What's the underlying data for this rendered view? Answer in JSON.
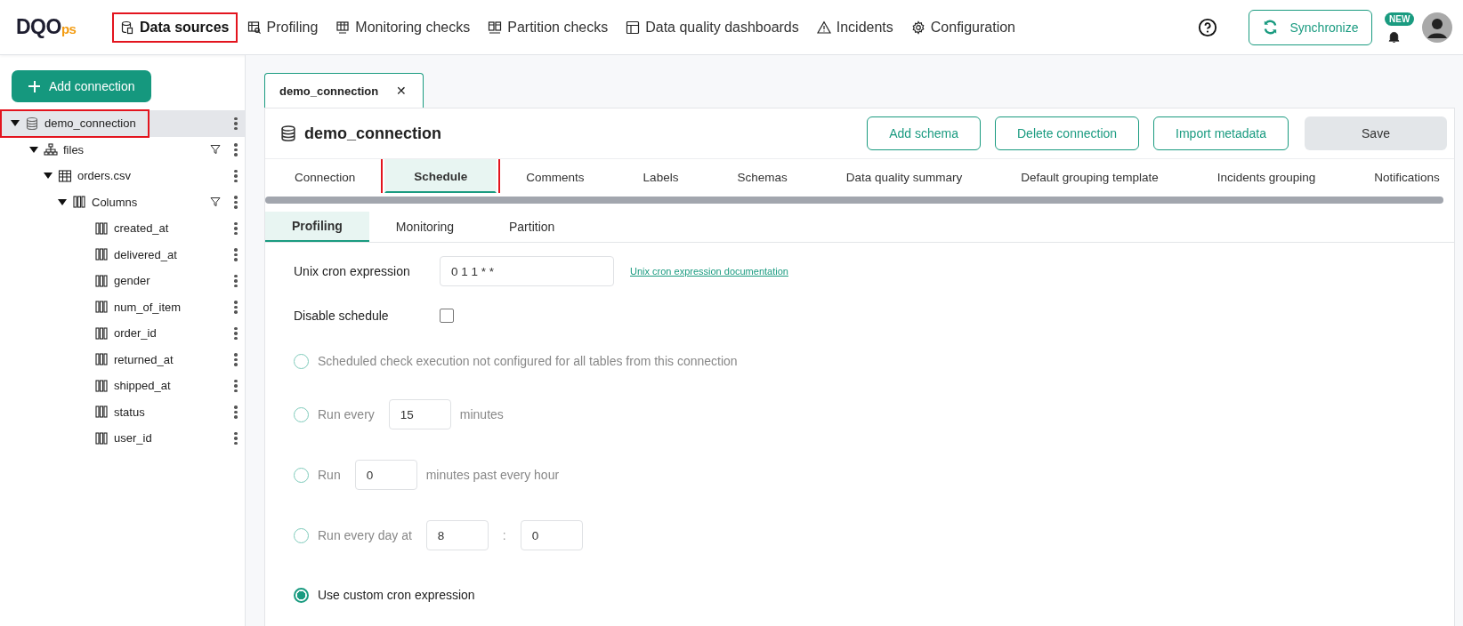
{
  "logo": {
    "main": "DQO",
    "suffix": "ps"
  },
  "nav": [
    {
      "label": "Data sources",
      "selected": true,
      "highlighted": true
    },
    {
      "label": "Profiling",
      "selected": false,
      "highlighted": false
    },
    {
      "label": "Monitoring checks",
      "selected": false,
      "highlighted": false
    },
    {
      "label": "Partition checks",
      "selected": false,
      "highlighted": false
    },
    {
      "label": "Data quality dashboards",
      "selected": false,
      "highlighted": false
    },
    {
      "label": "Incidents",
      "selected": false,
      "highlighted": false
    },
    {
      "label": "Configuration",
      "selected": false,
      "highlighted": false
    }
  ],
  "header_actions": {
    "synchronize": "Synchronize",
    "notification_badge": "NEW"
  },
  "sidebar": {
    "add_button": "Add connection",
    "tree": [
      {
        "label": "demo_connection",
        "kind": "connection",
        "expanded": true,
        "selected": true,
        "highlighted": true,
        "filter": false,
        "children": [
          {
            "label": "files",
            "kind": "schema",
            "expanded": true,
            "selected": false,
            "highlighted": false,
            "filter": true,
            "children": [
              {
                "label": "orders.csv",
                "kind": "table",
                "expanded": true,
                "selected": false,
                "highlighted": false,
                "filter": false,
                "children": [
                  {
                    "label": "Columns",
                    "kind": "columns",
                    "expanded": true,
                    "selected": false,
                    "highlighted": false,
                    "filter": true,
                    "children": [
                      {
                        "label": "created_at",
                        "kind": "column",
                        "selected": false,
                        "highlighted": false,
                        "filter": false
                      },
                      {
                        "label": "delivered_at",
                        "kind": "column",
                        "selected": false,
                        "highlighted": false,
                        "filter": false
                      },
                      {
                        "label": "gender",
                        "kind": "column",
                        "selected": false,
                        "highlighted": false,
                        "filter": false
                      },
                      {
                        "label": "num_of_item",
                        "kind": "column",
                        "selected": false,
                        "highlighted": false,
                        "filter": false
                      },
                      {
                        "label": "order_id",
                        "kind": "column",
                        "selected": false,
                        "highlighted": false,
                        "filter": false
                      },
                      {
                        "label": "returned_at",
                        "kind": "column",
                        "selected": false,
                        "highlighted": false,
                        "filter": false
                      },
                      {
                        "label": "shipped_at",
                        "kind": "column",
                        "selected": false,
                        "highlighted": false,
                        "filter": false
                      },
                      {
                        "label": "status",
                        "kind": "column",
                        "selected": false,
                        "highlighted": false,
                        "filter": false
                      },
                      {
                        "label": "user_id",
                        "kind": "column",
                        "selected": false,
                        "highlighted": false,
                        "filter": false
                      }
                    ]
                  }
                ]
              }
            ]
          }
        ]
      }
    ]
  },
  "open_tabs": [
    {
      "label": "demo_connection",
      "close": "✕",
      "selected": true
    }
  ],
  "panel": {
    "title": "demo_connection",
    "buttons": [
      {
        "label": "Add schema",
        "kind": "outline"
      },
      {
        "label": "Delete connection",
        "kind": "outline"
      },
      {
        "label": "Import metadata",
        "kind": "outline"
      },
      {
        "label": "Save",
        "kind": "disabled"
      }
    ],
    "tabs": [
      {
        "label": "Connection",
        "selected": false,
        "highlighted": false
      },
      {
        "label": "Schedule",
        "selected": true,
        "highlighted": true
      },
      {
        "label": "Comments",
        "selected": false,
        "highlighted": false
      },
      {
        "label": "Labels",
        "selected": false,
        "highlighted": false
      },
      {
        "label": "Schemas",
        "selected": false,
        "highlighted": false
      },
      {
        "label": "Data quality summary",
        "selected": false,
        "highlighted": false
      },
      {
        "label": "Default grouping template",
        "selected": false,
        "highlighted": false
      },
      {
        "label": "Incidents grouping",
        "selected": false,
        "highlighted": false
      },
      {
        "label": "Notifications",
        "selected": false,
        "highlighted": false
      }
    ],
    "subtabs": [
      {
        "label": "Profiling",
        "selected": true
      },
      {
        "label": "Monitoring",
        "selected": false
      },
      {
        "label": "Partition",
        "selected": false
      }
    ],
    "form": {
      "cron_label": "Unix cron expression",
      "cron_value": "0 1 1 * *",
      "cron_link": "Unix cron expression documentation",
      "disable_label": "Disable schedule",
      "disable_checked": false,
      "options": [
        {
          "kind": "text",
          "label": "Scheduled check execution not configured for all tables from this connection",
          "selected": false
        },
        {
          "kind": "every_minutes",
          "label": "Run every",
          "value": "15",
          "suffix": "minutes",
          "selected": false
        },
        {
          "kind": "past_hour",
          "label": "Run",
          "value": "0",
          "suffix": "minutes past every hour",
          "selected": false
        },
        {
          "kind": "daily",
          "label": "Run every day at",
          "hour": "8",
          "separator": ":",
          "minute": "0",
          "selected": false
        },
        {
          "kind": "custom",
          "label": "Use custom cron expression",
          "selected": true
        }
      ]
    }
  }
}
